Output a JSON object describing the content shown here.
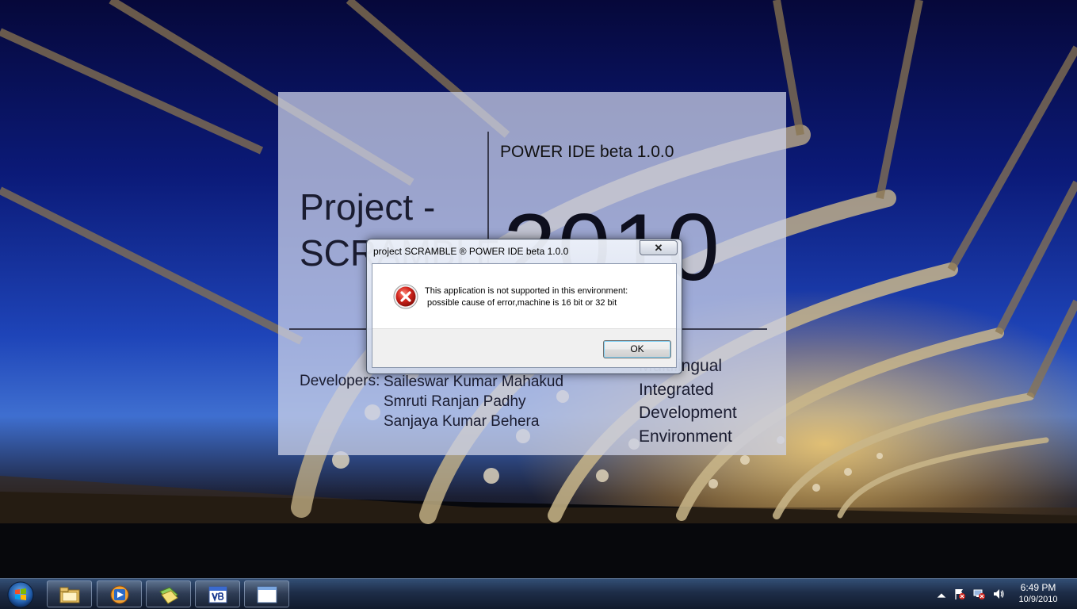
{
  "splash": {
    "title": "POWER IDE beta 1.0.0",
    "project_line1": "Project -",
    "project_line2": "SCRAMBLE",
    "year": "2010",
    "developers_label": "Developers:",
    "developers": [
      "Saileswar Kumar Mahakud",
      "Smruti Ranjan Padhy",
      "Sanjaya Kumar Behera"
    ],
    "tagline": [
      "Multilingual",
      "Integrated",
      "Development",
      "Environment"
    ]
  },
  "dialog": {
    "title": "project SCRAMBLE ® POWER IDE beta 1.0.0",
    "close_label": "✕",
    "message_line1": "This application is not supported in this environment:",
    "message_line2": " possible cause of error,machine is 16 bit or 32 bit",
    "ok_label": "OK",
    "icon": "error-icon"
  },
  "taskbar": {
    "start_icon": "windows-orb-icon",
    "pinned": [
      "file-explorer-icon",
      "media-player-icon",
      "folders-icon",
      "visual-basic-icon",
      "window-icon"
    ],
    "tray": [
      "show-hidden-icons-arrow",
      "action-center-flag-icon",
      "network-icon",
      "volume-icon"
    ],
    "time": "6:49 PM",
    "date": "10/9/2010"
  },
  "colors": {
    "dialog_frame": "#cdd6e8",
    "taskbar": "#16263f",
    "error_red": "#d0241c",
    "splash_panel": "#cdd2e8"
  }
}
